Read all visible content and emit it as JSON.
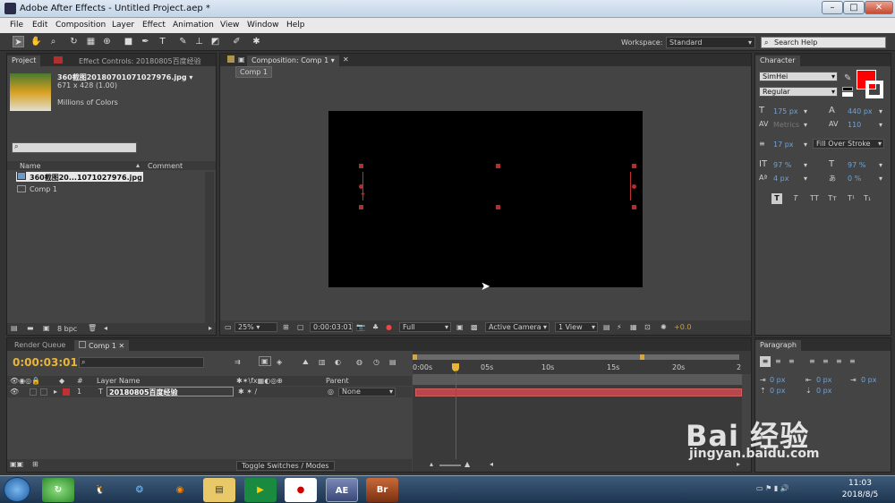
{
  "app": {
    "title": "Adobe After Effects - Untitled Project.aep *"
  },
  "menu": [
    "File",
    "Edit",
    "Composition",
    "Layer",
    "Effect",
    "Animation",
    "View",
    "Window",
    "Help"
  ],
  "toolbar": {
    "workspace_label": "Workspace:",
    "workspace_value": "Standard",
    "search_placeholder": "Search Help"
  },
  "project": {
    "tab_project": "Project",
    "tab_effect_controls": "Effect Controls: 20180805百度经验",
    "thumb_name": "360截图20180701071027976.jpg ▾",
    "thumb_dims": "671 x 428 (1.00)",
    "thumb_colors": "Millions of Colors",
    "col_name": "Name",
    "col_comment": "Comment",
    "items": [
      "360截图20...1071027976.jpg",
      "Comp 1"
    ],
    "bpc": "8 bpc"
  },
  "composition": {
    "tab": "Composition: Comp 1",
    "sub_tab": "Comp 1",
    "zoom": "25%",
    "timecode": "0:00:03:01",
    "resolution": "Full",
    "camera": "Active Camera",
    "view": "1 View",
    "exposure": "+0.0"
  },
  "character": {
    "tab": "Character",
    "font": "SimHei",
    "style": "Regular",
    "size": "175 px",
    "leading": "440 px",
    "kerning": "Metrics",
    "tracking": "110",
    "stroke_width": "17 px",
    "stroke_mode": "Fill Over Stroke",
    "vscale": "97 %",
    "hscale": "97 %",
    "baseline": "4 px",
    "tsume": "0 %",
    "styles": [
      "T",
      "T",
      "TT",
      "Tт",
      "T¹",
      "T₁"
    ],
    "fill_color": "#ff0000"
  },
  "paragraph": {
    "tab": "Paragraph",
    "values": [
      "0 px",
      "0 px",
      "0 px",
      "0 px",
      "0 px"
    ]
  },
  "timeline": {
    "tab_render": "Render Queue",
    "tab_comp": "Comp 1",
    "timecode": "0:00:03:01",
    "col_layer_name": "Layer Name",
    "col_parent": "Parent",
    "col_num": "#",
    "layer_index": "1",
    "layer_name": "20180805百度经验",
    "parent_value": "None",
    "toggle": "Toggle Switches / Modes",
    "ruler": [
      "0:00s",
      "05s",
      "10s",
      "15s",
      "20s",
      "2"
    ]
  },
  "taskbar": {
    "time": "11:03",
    "date": "2018/8/5",
    "apps": [
      "AE",
      "Br"
    ]
  },
  "watermark": {
    "text": "Bai  经验",
    "url": "jingyan.baidu.com"
  }
}
